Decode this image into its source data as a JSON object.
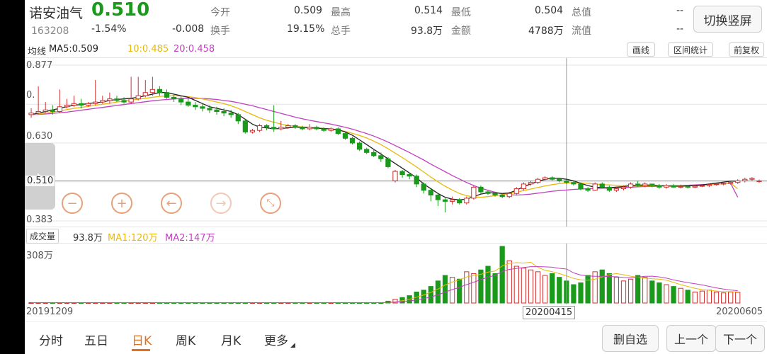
{
  "header": {
    "name": "诺安油气",
    "price": "0.510",
    "code": "163208",
    "change_pct": "-1.54%",
    "change_abs": "-0.008",
    "stats": [
      {
        "label": "今开",
        "value": "0.509"
      },
      {
        "label": "最高",
        "value": "0.514"
      },
      {
        "label": "最低",
        "value": "0.504"
      },
      {
        "label": "总值",
        "value": "--"
      },
      {
        "label": "换手",
        "value": "19.15%"
      },
      {
        "label": "总手",
        "value": "93.8万"
      },
      {
        "label": "金额",
        "value": "4788万"
      },
      {
        "label": "流值",
        "value": "--"
      }
    ],
    "switch_label": "切换竖屏"
  },
  "ma_bar": {
    "label": "均线",
    "ma5": "MA5:0.509",
    "ma10": "10:0.485",
    "ma20": "20:0.458",
    "buttons": [
      "画线",
      "区间统计",
      "前复权"
    ]
  },
  "price_axis": {
    "top": "0.877",
    "upper_mid": "0.",
    "mid": "0.630",
    "cursor": "0.510",
    "bottom": "0.383"
  },
  "volume_bar": {
    "label": "成交量",
    "volume": "93.8万",
    "ma1": "MA1:120万",
    "ma2": "MA2:147万",
    "axis_top": "308万"
  },
  "dates": {
    "start": "20191209",
    "cursor": "20200415",
    "end": "20200605"
  },
  "bottom_tabs": [
    "分时",
    "五日",
    "日K",
    "周K",
    "月K",
    "更多"
  ],
  "active_tab": "日K",
  "bottom_buttons": [
    "删自选",
    "上一个",
    "下一个"
  ],
  "colors": {
    "up": "#d0302f",
    "down": "#1a9a1a",
    "ma5": "#222222",
    "ma10": "#e8b90c",
    "ma20": "#c040c0",
    "accent": "#e0711e"
  },
  "icons": [
    "zoom-out-icon",
    "zoom-in-icon",
    "arrow-left-icon",
    "arrow-right-icon",
    "fit-screen-icon",
    "chevron-right-icon"
  ],
  "chart_data": {
    "type": "candlestick",
    "ylim": [
      0.383,
      0.877
    ],
    "candles": [
      {
        "o": 0.72,
        "c": 0.725,
        "h": 0.74,
        "l": 0.71
      },
      {
        "o": 0.725,
        "c": 0.73,
        "h": 0.81,
        "l": 0.72
      },
      {
        "o": 0.73,
        "c": 0.735,
        "h": 0.76,
        "l": 0.725
      },
      {
        "o": 0.735,
        "c": 0.73,
        "h": 0.75,
        "l": 0.72
      },
      {
        "o": 0.73,
        "c": 0.745,
        "h": 0.8,
        "l": 0.725
      },
      {
        "o": 0.745,
        "c": 0.75,
        "h": 0.77,
        "l": 0.74
      },
      {
        "o": 0.75,
        "c": 0.755,
        "h": 0.78,
        "l": 0.745
      },
      {
        "o": 0.755,
        "c": 0.75,
        "h": 0.77,
        "l": 0.74
      },
      {
        "o": 0.75,
        "c": 0.755,
        "h": 0.76,
        "l": 0.745
      },
      {
        "o": 0.755,
        "c": 0.76,
        "h": 0.83,
        "l": 0.75
      },
      {
        "o": 0.76,
        "c": 0.765,
        "h": 0.78,
        "l": 0.755
      },
      {
        "o": 0.765,
        "c": 0.77,
        "h": 0.79,
        "l": 0.755
      },
      {
        "o": 0.77,
        "c": 0.765,
        "h": 0.78,
        "l": 0.76
      },
      {
        "o": 0.765,
        "c": 0.76,
        "h": 0.775,
        "l": 0.755
      },
      {
        "o": 0.76,
        "c": 0.77,
        "h": 0.84,
        "l": 0.755
      },
      {
        "o": 0.77,
        "c": 0.78,
        "h": 0.84,
        "l": 0.765
      },
      {
        "o": 0.78,
        "c": 0.79,
        "h": 0.83,
        "l": 0.775
      },
      {
        "o": 0.79,
        "c": 0.8,
        "h": 0.84,
        "l": 0.78
      },
      {
        "o": 0.8,
        "c": 0.79,
        "h": 0.81,
        "l": 0.78
      },
      {
        "o": 0.79,
        "c": 0.775,
        "h": 0.8,
        "l": 0.77
      },
      {
        "o": 0.775,
        "c": 0.77,
        "h": 0.785,
        "l": 0.76
      },
      {
        "o": 0.77,
        "c": 0.76,
        "h": 0.78,
        "l": 0.75
      },
      {
        "o": 0.76,
        "c": 0.75,
        "h": 0.77,
        "l": 0.745
      },
      {
        "o": 0.75,
        "c": 0.745,
        "h": 0.76,
        "l": 0.735
      },
      {
        "o": 0.745,
        "c": 0.74,
        "h": 0.755,
        "l": 0.73
      },
      {
        "o": 0.74,
        "c": 0.735,
        "h": 0.75,
        "l": 0.725
      },
      {
        "o": 0.735,
        "c": 0.73,
        "h": 0.745,
        "l": 0.72
      },
      {
        "o": 0.73,
        "c": 0.725,
        "h": 0.74,
        "l": 0.715
      },
      {
        "o": 0.725,
        "c": 0.72,
        "h": 0.735,
        "l": 0.71
      },
      {
        "o": 0.72,
        "c": 0.7,
        "h": 0.725,
        "l": 0.69
      },
      {
        "o": 0.7,
        "c": 0.665,
        "h": 0.705,
        "l": 0.66
      },
      {
        "o": 0.665,
        "c": 0.67,
        "h": 0.675,
        "l": 0.66
      },
      {
        "o": 0.67,
        "c": 0.685,
        "h": 0.69,
        "l": 0.665
      },
      {
        "o": 0.685,
        "c": 0.68,
        "h": 0.69,
        "l": 0.67
      },
      {
        "o": 0.68,
        "c": 0.675,
        "h": 0.75,
        "l": 0.665
      },
      {
        "o": 0.675,
        "c": 0.68,
        "h": 0.7,
        "l": 0.67
      },
      {
        "o": 0.68,
        "c": 0.685,
        "h": 0.69,
        "l": 0.675
      },
      {
        "o": 0.685,
        "c": 0.68,
        "h": 0.69,
        "l": 0.675
      },
      {
        "o": 0.68,
        "c": 0.675,
        "h": 0.685,
        "l": 0.67
      },
      {
        "o": 0.675,
        "c": 0.68,
        "h": 0.69,
        "l": 0.67
      },
      {
        "o": 0.68,
        "c": 0.675,
        "h": 0.685,
        "l": 0.67
      },
      {
        "o": 0.675,
        "c": 0.67,
        "h": 0.68,
        "l": 0.665
      },
      {
        "o": 0.67,
        "c": 0.675,
        "h": 0.68,
        "l": 0.665
      },
      {
        "o": 0.675,
        "c": 0.66,
        "h": 0.68,
        "l": 0.655
      },
      {
        "o": 0.66,
        "c": 0.645,
        "h": 0.665,
        "l": 0.64
      },
      {
        "o": 0.645,
        "c": 0.63,
        "h": 0.65,
        "l": 0.625
      },
      {
        "o": 0.63,
        "c": 0.61,
        "h": 0.635,
        "l": 0.605
      },
      {
        "o": 0.61,
        "c": 0.6,
        "h": 0.615,
        "l": 0.595
      },
      {
        "o": 0.6,
        "c": 0.59,
        "h": 0.61,
        "l": 0.585
      },
      {
        "o": 0.59,
        "c": 0.58,
        "h": 0.6,
        "l": 0.57
      },
      {
        "o": 0.58,
        "c": 0.555,
        "h": 0.585,
        "l": 0.55
      },
      {
        "o": 0.51,
        "c": 0.54,
        "h": 0.545,
        "l": 0.505
      },
      {
        "o": 0.54,
        "c": 0.53,
        "h": 0.545,
        "l": 0.52
      },
      {
        "o": 0.53,
        "c": 0.525,
        "h": 0.535,
        "l": 0.515
      },
      {
        "o": 0.525,
        "c": 0.5,
        "h": 0.53,
        "l": 0.49
      },
      {
        "o": 0.5,
        "c": 0.48,
        "h": 0.505,
        "l": 0.47
      },
      {
        "o": 0.48,
        "c": 0.465,
        "h": 0.485,
        "l": 0.445
      },
      {
        "o": 0.465,
        "c": 0.45,
        "h": 0.47,
        "l": 0.43
      },
      {
        "o": 0.45,
        "c": 0.445,
        "h": 0.455,
        "l": 0.41
      },
      {
        "o": 0.445,
        "c": 0.45,
        "h": 0.46,
        "l": 0.435
      },
      {
        "o": 0.45,
        "c": 0.44,
        "h": 0.455,
        "l": 0.435
      },
      {
        "o": 0.44,
        "c": 0.455,
        "h": 0.46,
        "l": 0.435
      },
      {
        "o": 0.455,
        "c": 0.49,
        "h": 0.495,
        "l": 0.45
      },
      {
        "o": 0.49,
        "c": 0.475,
        "h": 0.495,
        "l": 0.47
      },
      {
        "o": 0.475,
        "c": 0.47,
        "h": 0.48,
        "l": 0.465
      },
      {
        "o": 0.47,
        "c": 0.465,
        "h": 0.475,
        "l": 0.46
      },
      {
        "o": 0.465,
        "c": 0.46,
        "h": 0.47,
        "l": 0.455
      },
      {
        "o": 0.46,
        "c": 0.47,
        "h": 0.475,
        "l": 0.455
      },
      {
        "o": 0.47,
        "c": 0.485,
        "h": 0.49,
        "l": 0.465
      },
      {
        "o": 0.485,
        "c": 0.5,
        "h": 0.505,
        "l": 0.48
      },
      {
        "o": 0.5,
        "c": 0.505,
        "h": 0.51,
        "l": 0.495
      },
      {
        "o": 0.505,
        "c": 0.515,
        "h": 0.52,
        "l": 0.5
      },
      {
        "o": 0.515,
        "c": 0.52,
        "h": 0.525,
        "l": 0.51
      },
      {
        "o": 0.52,
        "c": 0.515,
        "h": 0.525,
        "l": 0.51
      },
      {
        "o": 0.515,
        "c": 0.51,
        "h": 0.52,
        "l": 0.505
      },
      {
        "o": 0.51,
        "c": 0.505,
        "h": 0.515,
        "l": 0.5
      },
      {
        "o": 0.505,
        "c": 0.5,
        "h": 0.51,
        "l": 0.495
      },
      {
        "o": 0.5,
        "c": 0.485,
        "h": 0.505,
        "l": 0.48
      },
      {
        "o": 0.485,
        "c": 0.48,
        "h": 0.49,
        "l": 0.475
      },
      {
        "o": 0.48,
        "c": 0.5,
        "h": 0.505,
        "l": 0.478
      },
      {
        "o": 0.5,
        "c": 0.49,
        "h": 0.505,
        "l": 0.485
      },
      {
        "o": 0.49,
        "c": 0.48,
        "h": 0.495,
        "l": 0.475
      },
      {
        "o": 0.48,
        "c": 0.485,
        "h": 0.49,
        "l": 0.475
      },
      {
        "o": 0.485,
        "c": 0.49,
        "h": 0.495,
        "l": 0.48
      },
      {
        "o": 0.49,
        "c": 0.5,
        "h": 0.505,
        "l": 0.485
      },
      {
        "o": 0.5,
        "c": 0.495,
        "h": 0.51,
        "l": 0.49
      },
      {
        "o": 0.495,
        "c": 0.5,
        "h": 0.505,
        "l": 0.49
      },
      {
        "o": 0.5,
        "c": 0.495,
        "h": 0.5,
        "l": 0.49
      },
      {
        "o": 0.495,
        "c": 0.49,
        "h": 0.5,
        "l": 0.485
      },
      {
        "o": 0.49,
        "c": 0.495,
        "h": 0.5,
        "l": 0.485
      },
      {
        "o": 0.495,
        "c": 0.49,
        "h": 0.5,
        "l": 0.488
      },
      {
        "o": 0.49,
        "c": 0.492,
        "h": 0.498,
        "l": 0.486
      },
      {
        "o": 0.492,
        "c": 0.49,
        "h": 0.496,
        "l": 0.485
      },
      {
        "o": 0.49,
        "c": 0.493,
        "h": 0.498,
        "l": 0.487
      },
      {
        "o": 0.493,
        "c": 0.495,
        "h": 0.5,
        "l": 0.49
      },
      {
        "o": 0.495,
        "c": 0.498,
        "h": 0.502,
        "l": 0.49
      },
      {
        "o": 0.498,
        "c": 0.5,
        "h": 0.505,
        "l": 0.495
      },
      {
        "o": 0.5,
        "c": 0.502,
        "h": 0.506,
        "l": 0.496
      },
      {
        "o": 0.502,
        "c": 0.505,
        "h": 0.51,
        "l": 0.498
      },
      {
        "o": 0.505,
        "c": 0.51,
        "h": 0.515,
        "l": 0.5
      },
      {
        "o": 0.51,
        "c": 0.515,
        "h": 0.52,
        "l": 0.505
      },
      {
        "o": 0.515,
        "c": 0.518,
        "h": 0.522,
        "l": 0.51
      },
      {
        "o": 0.509,
        "c": 0.51,
        "h": 0.514,
        "l": 0.504
      }
    ],
    "volumes": [
      2,
      2,
      2,
      2,
      2,
      2,
      2,
      2,
      2,
      2,
      2,
      2,
      2,
      2,
      2,
      2,
      2,
      2,
      2,
      2,
      2,
      2,
      2,
      2,
      2,
      2,
      2,
      2,
      2,
      2,
      2,
      2,
      2,
      2,
      2,
      2,
      2,
      2,
      2,
      2,
      2,
      2,
      2,
      2,
      2,
      2,
      2,
      2,
      2,
      2,
      10,
      20,
      30,
      40,
      60,
      70,
      90,
      120,
      150,
      140,
      130,
      170,
      160,
      180,
      200,
      160,
      308,
      230,
      200,
      190,
      180,
      170,
      150,
      160,
      140,
      120,
      100,
      110,
      150,
      170,
      180,
      160,
      140,
      120,
      130,
      150,
      140,
      120,
      110,
      100,
      90,
      80,
      70,
      60,
      65,
      70,
      60,
      55,
      60,
      58
    ],
    "ma5": [
      0.72,
      0.725,
      0.73,
      0.735,
      0.74,
      0.745,
      0.75,
      0.752,
      0.755,
      0.758,
      0.76,
      0.765,
      0.768,
      0.77,
      0.772,
      0.775,
      0.78,
      0.785,
      0.79,
      0.79,
      0.785,
      0.78,
      0.775,
      0.765,
      0.755,
      0.745,
      0.74,
      0.735,
      0.73,
      0.72,
      0.705,
      0.69,
      0.68,
      0.678,
      0.675,
      0.676,
      0.678,
      0.68,
      0.68,
      0.678,
      0.677,
      0.676,
      0.675,
      0.672,
      0.665,
      0.655,
      0.64,
      0.625,
      0.61,
      0.595,
      0.58,
      0.565,
      0.55,
      0.535,
      0.52,
      0.5,
      0.485,
      0.47,
      0.458,
      0.452,
      0.45,
      0.452,
      0.46,
      0.468,
      0.472,
      0.472,
      0.47,
      0.472,
      0.48,
      0.492,
      0.5,
      0.508,
      0.515,
      0.518,
      0.518,
      0.515,
      0.51,
      0.502,
      0.495,
      0.49,
      0.488,
      0.488,
      0.49,
      0.492,
      0.495,
      0.496,
      0.497,
      0.496,
      0.495,
      0.494,
      0.493,
      0.493,
      0.494,
      0.495,
      0.497,
      0.5,
      0.503,
      0.506,
      0.509,
      0.509
    ],
    "ma10": [
      0.72,
      0.722,
      0.725,
      0.728,
      0.732,
      0.736,
      0.74,
      0.743,
      0.746,
      0.75,
      0.753,
      0.756,
      0.76,
      0.763,
      0.766,
      0.769,
      0.772,
      0.775,
      0.778,
      0.779,
      0.78,
      0.779,
      0.777,
      0.774,
      0.77,
      0.765,
      0.76,
      0.755,
      0.748,
      0.74,
      0.73,
      0.72,
      0.71,
      0.702,
      0.696,
      0.69,
      0.686,
      0.683,
      0.681,
      0.68,
      0.678,
      0.676,
      0.674,
      0.671,
      0.667,
      0.661,
      0.654,
      0.646,
      0.636,
      0.625,
      0.612,
      0.598,
      0.584,
      0.569,
      0.554,
      0.538,
      0.522,
      0.507,
      0.493,
      0.481,
      0.47,
      0.463,
      0.459,
      0.458,
      0.46,
      0.463,
      0.466,
      0.47,
      0.474,
      0.479,
      0.484,
      0.489,
      0.494,
      0.498,
      0.501,
      0.503,
      0.504,
      0.503,
      0.502,
      0.5,
      0.498,
      0.497,
      0.496,
      0.495,
      0.494,
      0.494,
      0.494,
      0.494,
      0.494,
      0.494,
      0.494,
      0.494,
      0.494,
      0.495,
      0.496,
      0.497,
      0.499,
      0.501,
      0.503,
      0.485
    ],
    "ma20": [
      0.72,
      0.721,
      0.722,
      0.724,
      0.726,
      0.728,
      0.731,
      0.734,
      0.737,
      0.74,
      0.743,
      0.746,
      0.749,
      0.752,
      0.755,
      0.758,
      0.761,
      0.764,
      0.766,
      0.768,
      0.77,
      0.771,
      0.772,
      0.772,
      0.771,
      0.77,
      0.768,
      0.765,
      0.762,
      0.758,
      0.753,
      0.748,
      0.742,
      0.736,
      0.73,
      0.724,
      0.718,
      0.712,
      0.707,
      0.702,
      0.698,
      0.694,
      0.69,
      0.685,
      0.68,
      0.674,
      0.667,
      0.66,
      0.652,
      0.643,
      0.633,
      0.622,
      0.611,
      0.6,
      0.588,
      0.576,
      0.563,
      0.551,
      0.539,
      0.527,
      0.516,
      0.505,
      0.495,
      0.487,
      0.48,
      0.474,
      0.469,
      0.466,
      0.465,
      0.466,
      0.468,
      0.471,
      0.474,
      0.477,
      0.479,
      0.481,
      0.483,
      0.484,
      0.485,
      0.486,
      0.487,
      0.487,
      0.488,
      0.489,
      0.49,
      0.491,
      0.492,
      0.492,
      0.493,
      0.494,
      0.495,
      0.495,
      0.496,
      0.497,
      0.498,
      0.499,
      0.5,
      0.501,
      0.502,
      0.458
    ]
  }
}
